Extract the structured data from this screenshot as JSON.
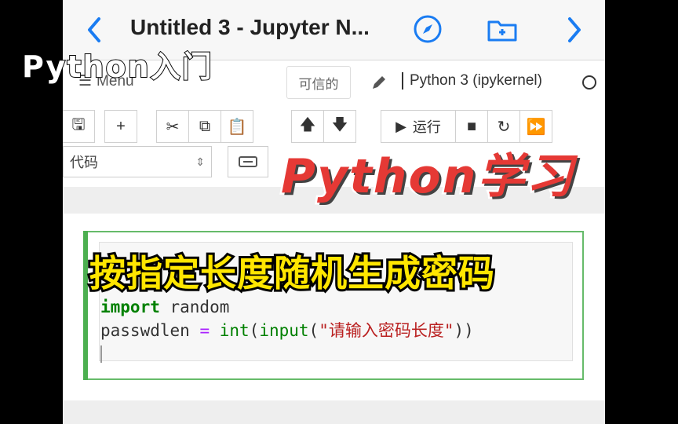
{
  "browser": {
    "tab_title": "Untitled 3 - Jupyter N..."
  },
  "notebook": {
    "menu_label": "Menu",
    "trusted_label": "可信的",
    "kernel_label": "Python 3 (ipykernel)",
    "run_label": "运行",
    "cell_type": "代码"
  },
  "cell": {
    "code_line1_kw": "import",
    "code_line1_rest": " random",
    "code_line2_var": "passwdlen",
    "code_line2_op": " = ",
    "code_line2_fn1": "int",
    "code_line2_p1": "(",
    "code_line2_fn2": "input",
    "code_line2_p2": "(",
    "code_line2_str": "\"请输入密码长度\"",
    "code_line2_p3": "))"
  },
  "overlay": {
    "top_label": "Python入门",
    "brand_label": "Python学习",
    "caption": "按指定长度随机生成密码"
  },
  "colors": {
    "accent_blue": "#1a7cf2",
    "cell_green": "#4caf50",
    "brand_red": "#e53935",
    "caption_yellow": "#ffe600"
  }
}
